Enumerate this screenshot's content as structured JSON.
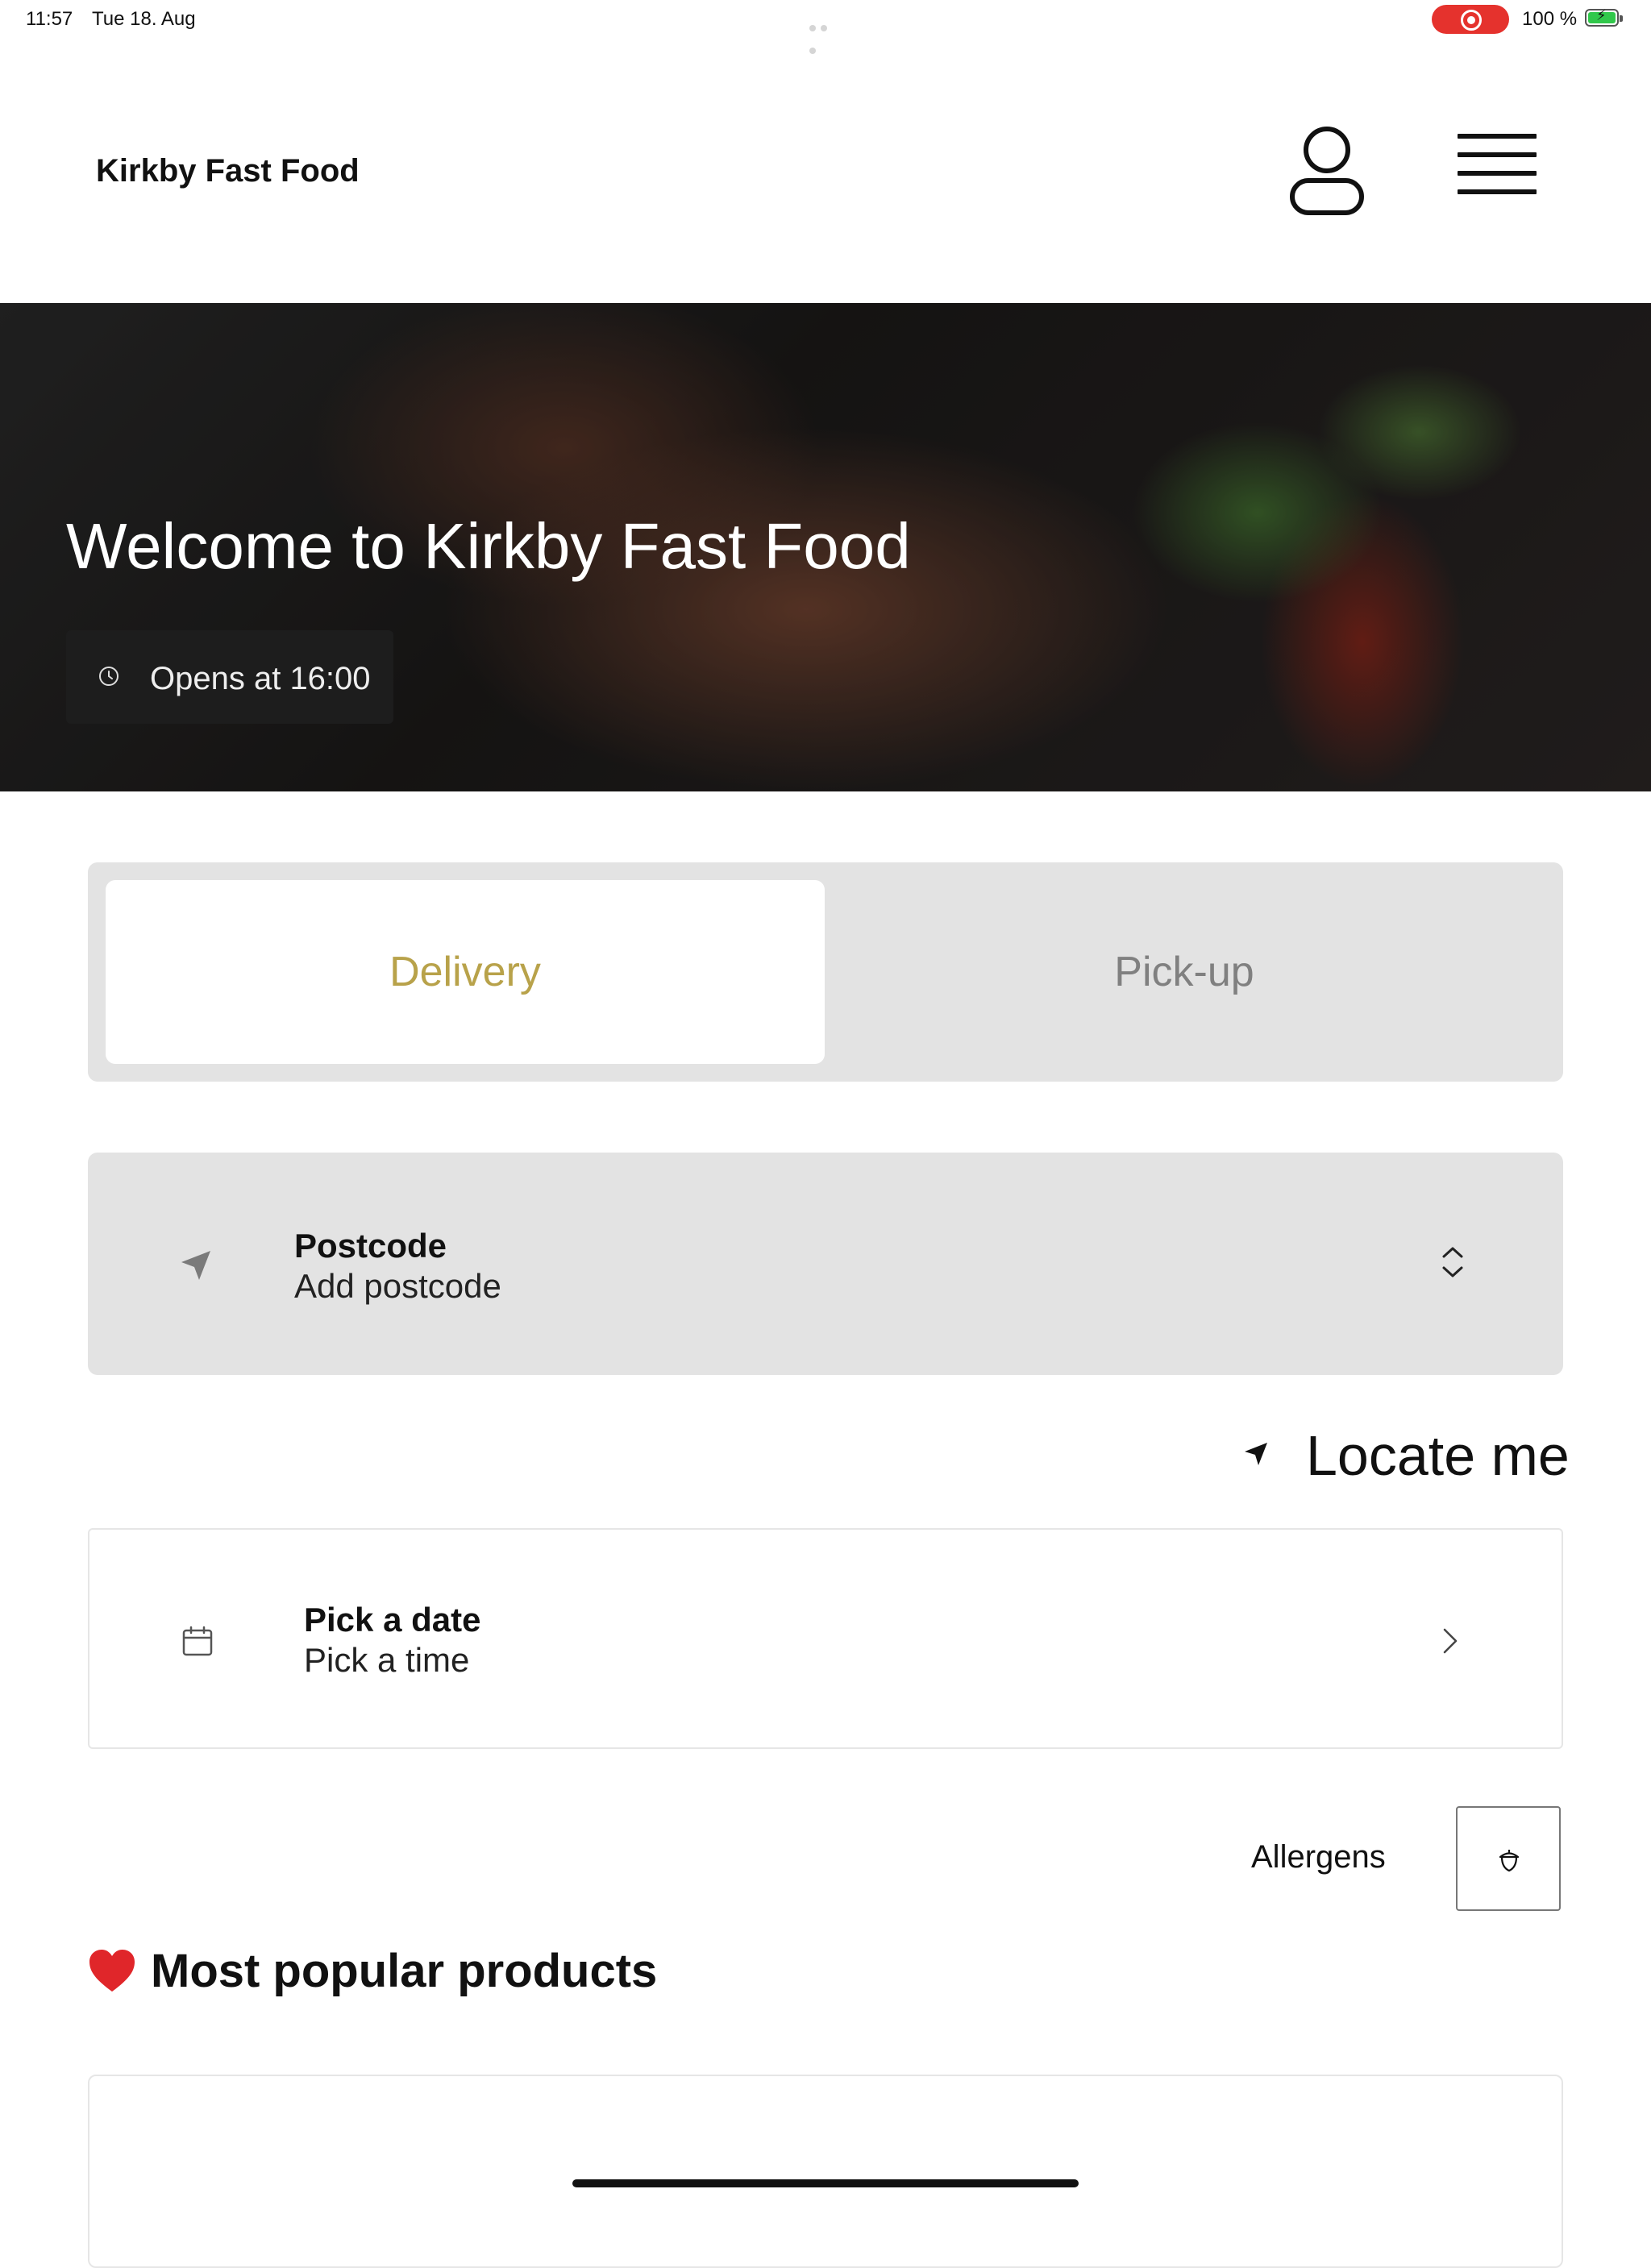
{
  "status_bar": {
    "time": "11:57",
    "date": "Tue 18. Aug",
    "battery_percent": "100 %",
    "recording_color": "#e5322d",
    "battery_color": "#31c84b"
  },
  "header": {
    "brand": "Kirkby Fast Food",
    "account_icon": "user-icon",
    "menu_icon": "hamburger-menu-icon"
  },
  "hero": {
    "title": "Welcome to Kirkby Fast Food",
    "opening": "Opens at 16:00",
    "opening_icon": "clock-icon"
  },
  "order_mode": {
    "tabs": [
      {
        "label": "Delivery",
        "active": true
      },
      {
        "label": "Pick-up",
        "active": false
      }
    ],
    "active_color": "#b8a24a"
  },
  "postcode": {
    "label": "Postcode",
    "value": "Add postcode",
    "icon": "navigation-arrow-icon",
    "toggle_icon": "chevron-up-down-icon"
  },
  "locate": {
    "label": "Locate me",
    "icon": "location-arrow-icon"
  },
  "schedule": {
    "date_label": "Pick a date",
    "time_label": "Pick a time",
    "icon": "calendar-icon",
    "chevron_icon": "chevron-right-icon"
  },
  "allergens": {
    "label": "Allergens",
    "icon": "acorn-icon"
  },
  "popular": {
    "title": "Most popular products",
    "icon": "heart-icon"
  }
}
